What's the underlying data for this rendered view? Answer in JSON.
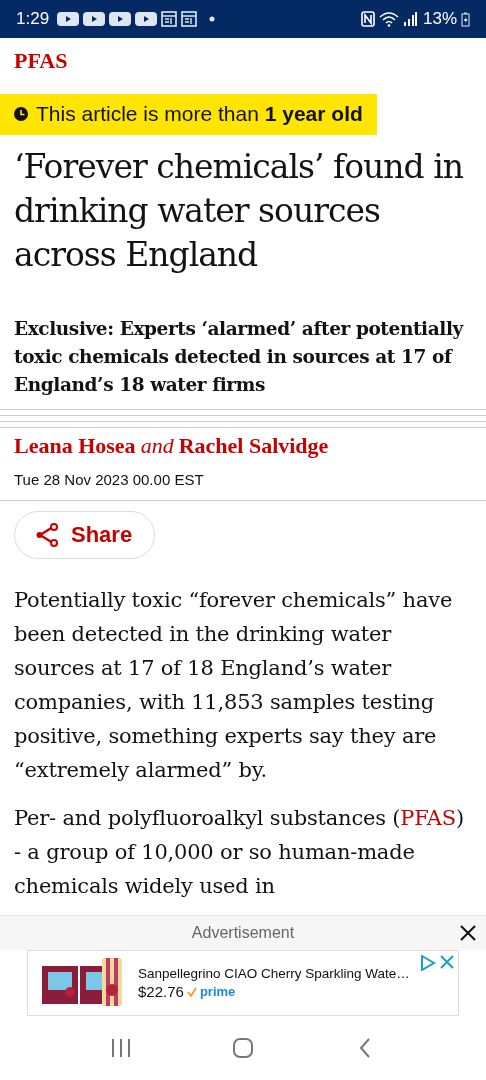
{
  "status_bar": {
    "time": "1:29",
    "battery": "13%"
  },
  "section": "PFAS",
  "age_notice": {
    "text": "This article is more than **1 year old**"
  },
  "headline": "‘Forever chemicals’ found in drinking water sources across England",
  "standfirst": "Exclusive: Experts ‘alarmed’ after potentially toxic chemicals detected in sources at 17 of England’s 18 water firms",
  "byline": {
    "authors": [
      "Leana Hosea",
      "Rachel Salvidge"
    ],
    "joiner": "and"
  },
  "dateline": "Tue 28 Nov 2023 00.00 EST",
  "share_button": "Share",
  "paragraphs": [
    {
      "parts": [
        {
          "kind": "text",
          "text": "Potentially toxic “forever chemicals” have been detected in the drinking water sources at 17 of 18 England’s water companies, with 11,853 samples testing positive, something experts say they are “extremely alarmed” by."
        }
      ]
    },
    {
      "parts": [
        {
          "kind": "text",
          "text": "Per- and polyfluoroalkyl substances ("
        },
        {
          "kind": "link",
          "text": "PFAS"
        },
        {
          "kind": "text",
          "text": ") - a group of 10,000 or so human-made chemicals widely used in"
        }
      ]
    }
  ],
  "ad": {
    "label": "Advertisement",
    "product": "Sanpellegrino CIAO Cherry Sparkling Wate…",
    "price": "$22.76",
    "badge": "prime"
  }
}
